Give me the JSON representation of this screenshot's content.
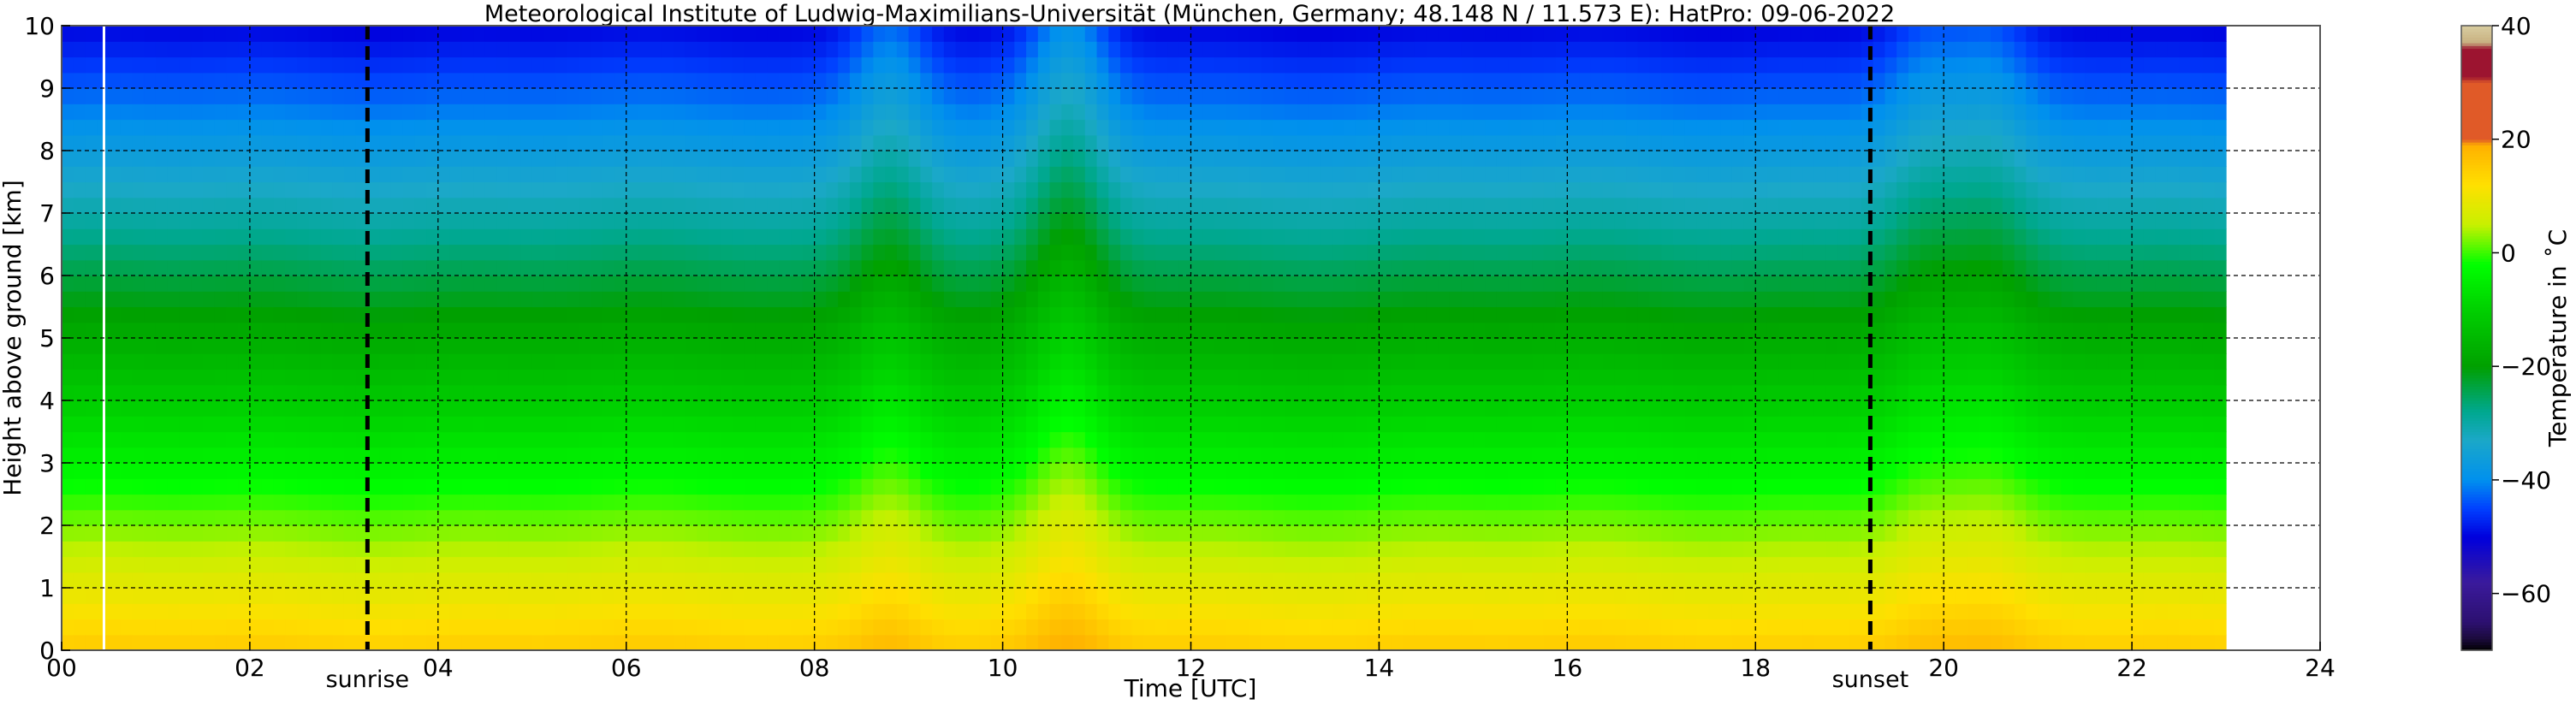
{
  "chart_data": {
    "type": "heatmap",
    "title": "Meteorological Institute of Ludwig-Maximilians-Universität (München, Germany; 48.148 N / 11.573 E):    HatPro: 09-06-2022",
    "xlabel": "Time [UTC]",
    "ylabel": "Height above ground [km]",
    "xlim": [
      0,
      24
    ],
    "ylim": [
      0,
      10
    ],
    "x_ticks": [
      0,
      2,
      4,
      6,
      8,
      10,
      12,
      14,
      16,
      18,
      20,
      22,
      24
    ],
    "x_tick_labels": [
      "00",
      "02",
      "04",
      "06",
      "08",
      "10",
      "12",
      "14",
      "16",
      "18",
      "20",
      "22",
      "24"
    ],
    "y_ticks": [
      0,
      1,
      2,
      3,
      4,
      5,
      6,
      7,
      8,
      9,
      10
    ],
    "y_tick_labels": [
      "0",
      "1",
      "2",
      "3",
      "4",
      "5",
      "6",
      "7",
      "8",
      "9",
      "10"
    ],
    "grid": true,
    "data_x_range": [
      0,
      23.0
    ],
    "gap_line_time": 0.45,
    "surface_temperature_c": 15,
    "lapse_rate_c_per_km": 6.5,
    "warm_events": [
      {
        "time": 8.8,
        "delta_c": 3
      },
      {
        "time": 10.7,
        "delta_c": 4
      },
      {
        "time": 19.8,
        "delta_c": 2
      },
      {
        "time": 20.5,
        "delta_c": 2
      }
    ],
    "events": [
      {
        "label": "sunrise",
        "time": 3.25
      },
      {
        "label": "sunset",
        "time": 19.22
      }
    ],
    "colorbar": {
      "label": "Temperature in $^\\circ$C",
      "label_display": "Temperature in ˚C",
      "min": -70,
      "max": 40,
      "ticks": [
        40,
        20,
        0,
        -20,
        -40,
        -60
      ],
      "tick_labels": [
        "40",
        "20",
        "0",
        "−20",
        "−40",
        "−60"
      ],
      "stops": [
        {
          "t": -70,
          "color": "#000000"
        },
        {
          "t": -68,
          "color": "#1a0a3a"
        },
        {
          "t": -65,
          "color": "#2d1070"
        },
        {
          "t": -58,
          "color": "#3a1a9c"
        },
        {
          "t": -50,
          "color": "#0000dd"
        },
        {
          "t": -45,
          "color": "#0040ff"
        },
        {
          "t": -40,
          "color": "#0090ee"
        },
        {
          "t": -33,
          "color": "#1ba8c8"
        },
        {
          "t": -28,
          "color": "#00a890"
        },
        {
          "t": -20,
          "color": "#00a000"
        },
        {
          "t": -10,
          "color": "#00d000"
        },
        {
          "t": -2,
          "color": "#00ff00"
        },
        {
          "t": 5,
          "color": "#c8f000"
        },
        {
          "t": 12,
          "color": "#ffe000"
        },
        {
          "t": 19,
          "color": "#ffb000"
        },
        {
          "t": 20,
          "color": "#e05a28"
        },
        {
          "t": 30,
          "color": "#e05a28"
        },
        {
          "t": 31,
          "color": "#9c1430"
        },
        {
          "t": 36,
          "color": "#9c1430"
        },
        {
          "t": 37,
          "color": "#c8b080"
        },
        {
          "t": 40,
          "color": "#d8cca0"
        }
      ]
    }
  }
}
